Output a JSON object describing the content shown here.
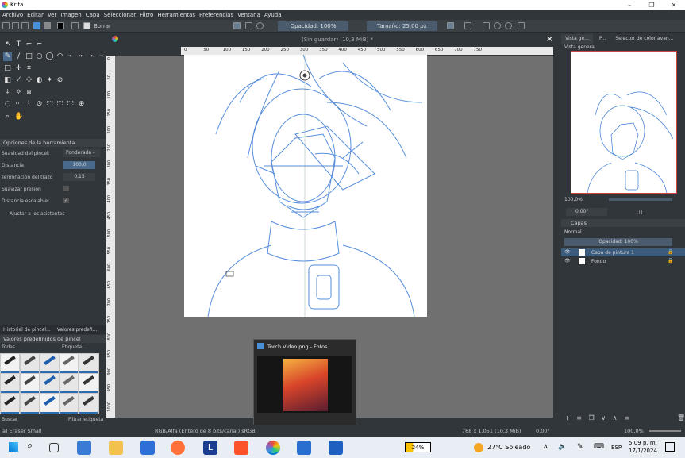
{
  "app": {
    "title": "Krita"
  },
  "menu": [
    "Archivo",
    "Editar",
    "Ver",
    "Imagen",
    "Capa",
    "Seleccionar",
    "Filtro",
    "Herramientas",
    "Preferencias",
    "Ventana",
    "Ayuda"
  ],
  "toolbar": {
    "brush_name": "Borrar",
    "opacity": "Opacidad: 100%",
    "size": "Tamaño: 25,00 px"
  },
  "document": {
    "tab_title": "(Sin guardar)  (10,3 MiB) *"
  },
  "ruler": {
    "h_ticks": [
      "0",
      "50",
      "100",
      "150",
      "200",
      "250",
      "300",
      "350",
      "400",
      "450",
      "500",
      "550",
      "600",
      "650",
      "700",
      "750"
    ],
    "v_ticks": [
      "0",
      "50",
      "100",
      "150",
      "200",
      "250",
      "300",
      "350",
      "400",
      "450",
      "500",
      "550",
      "600",
      "650",
      "700",
      "750",
      "800",
      "850",
      "900",
      "950",
      "1000"
    ]
  },
  "tool_options": {
    "title": "Opciones de la herramienta",
    "smoothing_label": "Suavidad del pincel:",
    "smoothing_value": "Ponderada",
    "distance_label": "Distancia",
    "distance_value": "100,0",
    "stroke_end_label": "Terminación del trazo",
    "stroke_end_value": "0,15",
    "smooth_pressure_label": "Suavizar presión",
    "scalable_distance_label": "Distancia escalable:",
    "assistants_label": "Ajustar a los asistentes"
  },
  "presets": {
    "tab1": "Historial de pincel...",
    "tab2": "Valores predefi...",
    "title": "Valores predefinidos de pincel",
    "filter_all": "Todas",
    "tag_label": "Etiqueta...",
    "search_placeholder": "Buscar",
    "filter_tag": "Filtrar etiqueta",
    "current": "a) Eraser Small"
  },
  "right": {
    "tab1": "Vista ge...",
    "tab2": "P...",
    "tab3": "Selector de color avan...",
    "overview_title": "Vista general",
    "zoom": "100,0%",
    "rotation": "0,00°",
    "layers_title": "Capas",
    "blend": "Normal",
    "layer_opacity": "Opacidad:  100%",
    "layers": [
      {
        "name": "Capa de pintura 1",
        "selected": true
      },
      {
        "name": "Fondo",
        "selected": false
      }
    ]
  },
  "status": {
    "color_info": "RGB/Alfa (Entero de 8 bits/canal)  sRGB",
    "dims": "768 x 1.051 (10,3 MiB)",
    "rotation": "0,00°",
    "zoom": "100,0%"
  },
  "popup": {
    "title": "Torch Video.png - Fotos"
  },
  "taskbar": {
    "battery": "24%",
    "weather": "27°C  Soleado",
    "lang": "ESP",
    "time": "5:09 p. m.",
    "date": "17/1/2024"
  }
}
